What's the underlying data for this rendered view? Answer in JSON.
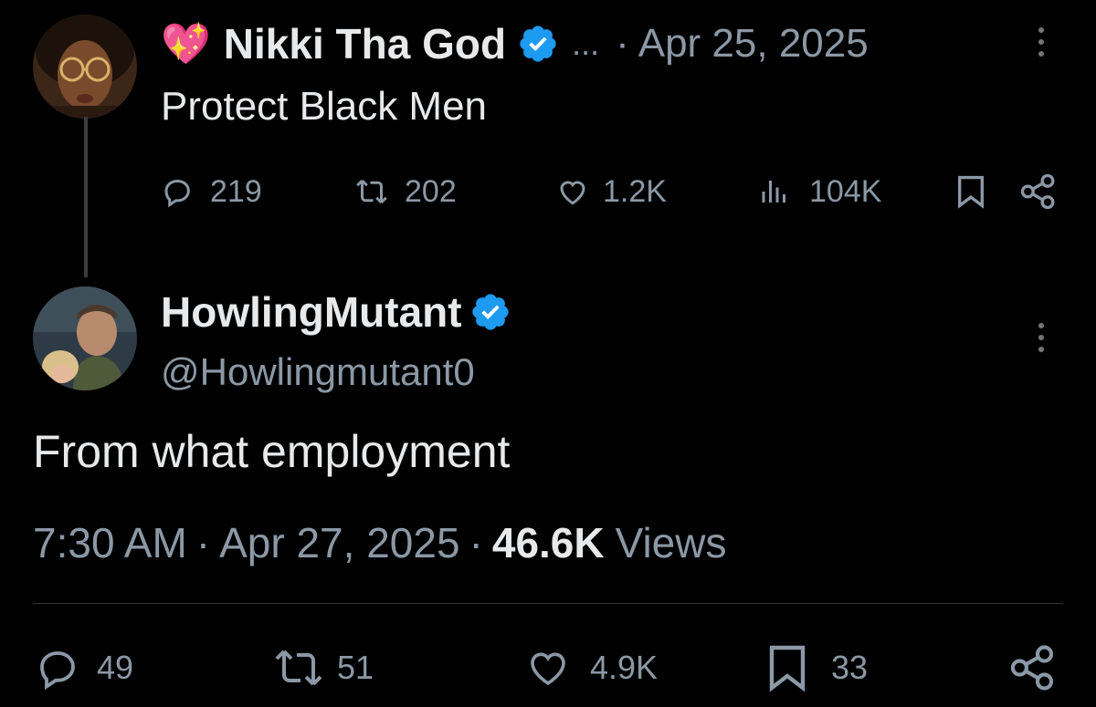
{
  "parent_tweet": {
    "display_name": "Nikki Tha God",
    "name_emoji": "💖",
    "truncation": "...",
    "separator": "·",
    "date": "Apr 25, 2025",
    "text": "Protect Black Men",
    "stats": {
      "replies": "219",
      "reposts": "202",
      "likes": "1.2K",
      "views": "104K"
    }
  },
  "main_tweet": {
    "display_name": "HowlingMutant",
    "handle": "@Howlingmutant0",
    "text": "From what employment",
    "time": "7:30 AM",
    "separator": "·",
    "date": "Apr 27, 2025",
    "views_count": "46.6K",
    "views_label": "Views",
    "stats": {
      "replies": "49",
      "reposts": "51",
      "likes": "4.9K",
      "bookmarks": "33"
    }
  },
  "colors": {
    "background": "#000000",
    "text_primary": "#e7e9ea",
    "text_muted": "#8b98a5",
    "verified": "#1d9bf0",
    "divider": "#2f3336"
  }
}
